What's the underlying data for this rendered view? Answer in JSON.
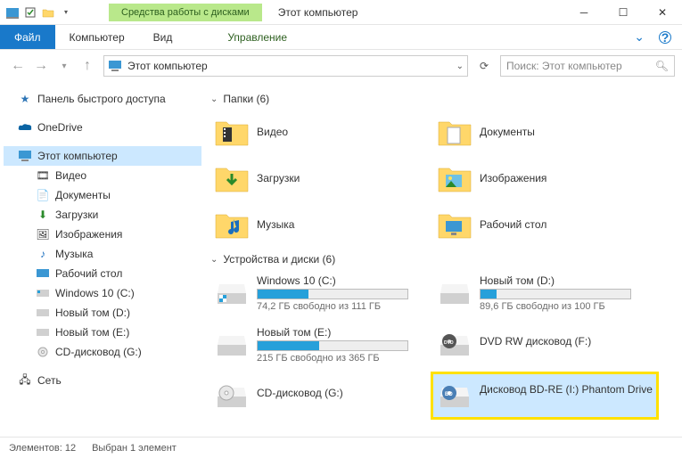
{
  "title": {
    "context_tab": "Средства работы с дисками",
    "window_title": "Этот компьютер"
  },
  "ribbon": {
    "file": "Файл",
    "computer": "Компьютер",
    "view": "Вид",
    "manage": "Управление"
  },
  "address": {
    "crumb": "Этот компьютер",
    "search_placeholder": "Поиск: Этот компьютер"
  },
  "sidebar": {
    "quick_access": "Панель быстрого доступа",
    "onedrive": "OneDrive",
    "this_pc": "Этот компьютер",
    "children": {
      "video": "Видео",
      "documents": "Документы",
      "downloads": "Загрузки",
      "pictures": "Изображения",
      "music": "Музыка",
      "desktop": "Рабочий стол",
      "win10c": "Windows 10 (C:)",
      "newd": "Новый том (D:)",
      "newe": "Новый том (E:)",
      "cdg": "CD-дисковод (G:)"
    },
    "network": "Сеть"
  },
  "groups": {
    "folders": "Папки (6)",
    "drives": "Устройства и диски (6)"
  },
  "folders": {
    "video": "Видео",
    "documents": "Документы",
    "downloads": "Загрузки",
    "pictures": "Изображения",
    "music": "Музыка",
    "desktop": "Рабочий стол"
  },
  "drives": {
    "c": {
      "name": "Windows 10 (C:)",
      "free": "74,2 ГБ свободно из 111 ГБ",
      "fill_pct": 34
    },
    "d": {
      "name": "Новый том (D:)",
      "free": "89,6 ГБ свободно из 100 ГБ",
      "fill_pct": 11
    },
    "e": {
      "name": "Новый том (E:)",
      "free": "215 ГБ свободно из 365 ГБ",
      "fill_pct": 41
    },
    "f": {
      "name": "DVD RW дисковод (F:)"
    },
    "g": {
      "name": "CD-дисковод (G:)"
    },
    "i": {
      "name": "Дисковод BD-RE (I:) Phantom Drive"
    }
  },
  "status": {
    "items": "Элементов: 12",
    "selected": "Выбран 1 элемент"
  }
}
